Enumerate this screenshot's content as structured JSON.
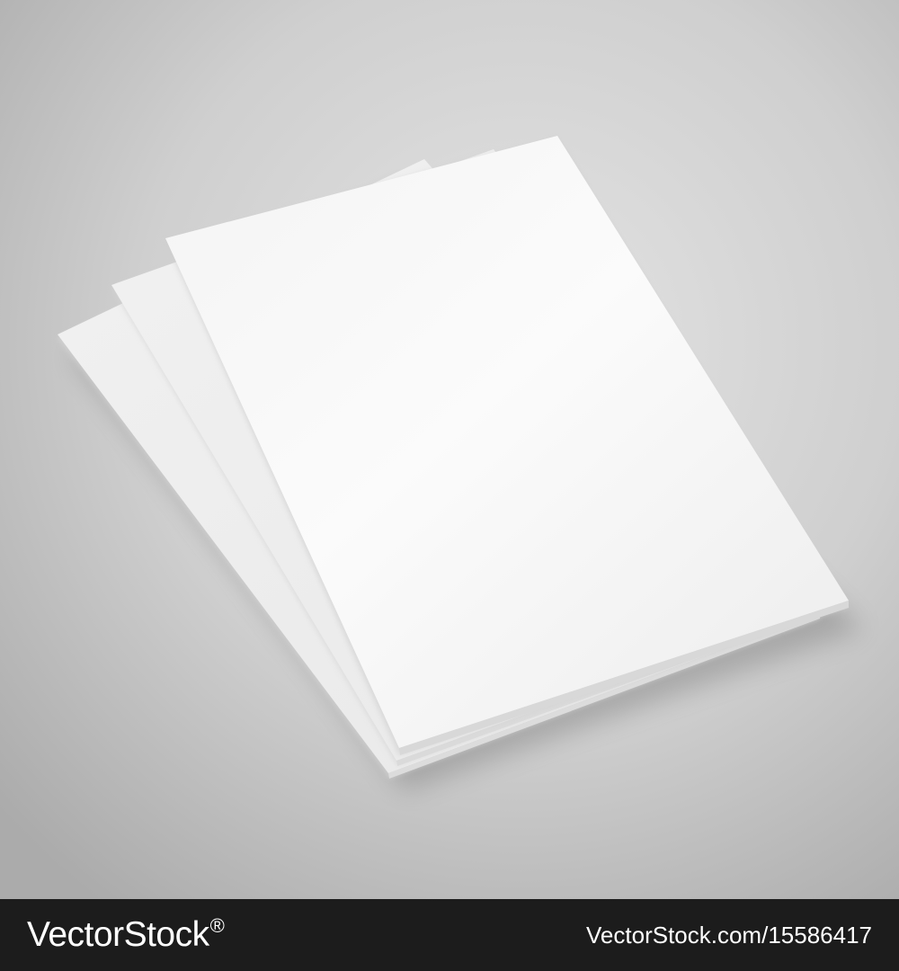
{
  "scene": {
    "subject": "three-sheets-paper-mockup",
    "background_color": "#d3d3d3",
    "paper_color": "#ffffff",
    "paper_edge_color": "#e6e6e6"
  },
  "watermark": {
    "brand_name": "VectorStock",
    "registered_mark": "®",
    "image_id": "VectorStock.com/15586417",
    "bar_color": "#1c1c1c",
    "text_color": "#ffffff"
  }
}
